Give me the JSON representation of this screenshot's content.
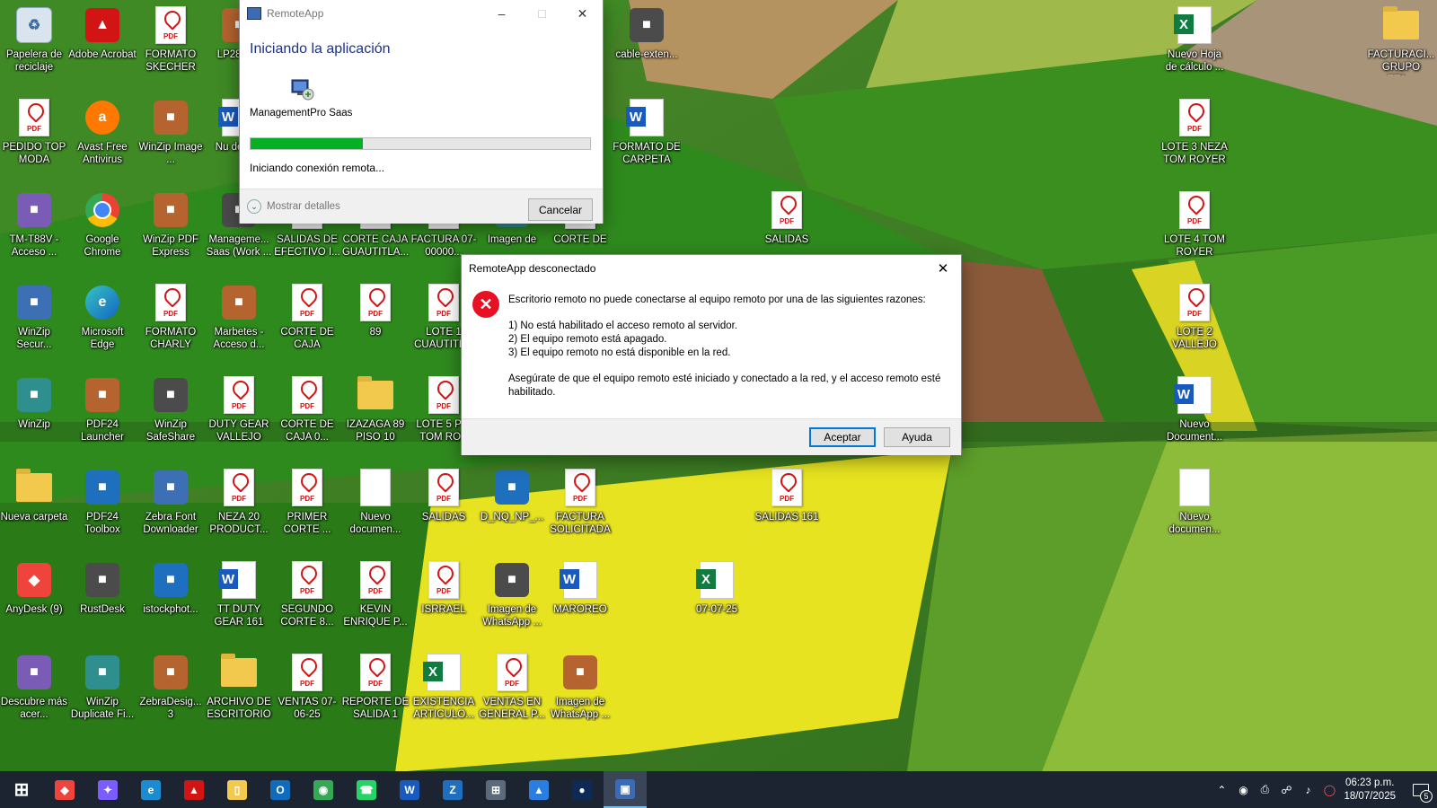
{
  "remoteapp_window": {
    "title": "RemoteApp",
    "heading": "Iniciando la aplicación",
    "app_name": "ManagementPro Saas",
    "progress": 0.33,
    "status": "Iniciando conexión remota...",
    "details_label": "Mostrar detalles",
    "cancel_label": "Cancelar"
  },
  "error_dialog": {
    "title": "RemoteApp desconectado",
    "message": "Escritorio remoto no puede conectarse al equipo remoto por una de las siguientes razones:",
    "reasons": [
      "1) No está habilitado el acceso remoto al servidor.",
      "2) El equipo remoto está apagado.",
      "3) El equipo remoto no está disponible en la red."
    ],
    "advice": "Asegúrate de que el equipo remoto esté iniciado y conectado a la red, y el acceso remoto esté habilitado.",
    "ok_label": "Aceptar",
    "help_label": "Ayuda"
  },
  "desktop_icons": [
    {
      "label": "Papelera de reciclaje",
      "type": "recycle"
    },
    {
      "label": "Adobe Acrobat",
      "type": "acrobat"
    },
    {
      "label": "FORMATO SKECHER",
      "type": "pdf"
    },
    {
      "label": "LP28 Acc",
      "type": "generic"
    },
    {
      "label": "cable-exten...",
      "type": "generic"
    },
    {
      "label": "Nuevo Hoja de cálculo ...",
      "type": "excel"
    },
    {
      "label": "FACTURACI... GRUPO ETA...",
      "type": "folder"
    },
    {
      "label": "PEDIDO TOP MODA",
      "type": "pdf"
    },
    {
      "label": "Avast Free Antivirus",
      "type": "avast"
    },
    {
      "label": "WinZip Image ...",
      "type": "generic"
    },
    {
      "label": "Nu docum",
      "type": "word"
    },
    {
      "label": "FORMATO DE CARPETA",
      "type": "word"
    },
    {
      "label": "LOTE 3 NEZA TOM ROYER",
      "type": "pdf"
    },
    {
      "label": "TM-T88V - Acceso ...",
      "type": "generic"
    },
    {
      "label": "Google Chrome",
      "type": "chrome"
    },
    {
      "label": "WinZip PDF Express",
      "type": "generic"
    },
    {
      "label": "Manageme... Saas (Work ...",
      "type": "generic"
    },
    {
      "label": "SALIDAS DE EFECTIVO I...",
      "type": "pdf"
    },
    {
      "label": "CORTE CAJA GUAUTITLA...",
      "type": "pdf"
    },
    {
      "label": "FACTURA 07-00000...",
      "type": "pdf"
    },
    {
      "label": "Imagen de",
      "type": "generic"
    },
    {
      "label": "CORTE DE",
      "type": "pdf"
    },
    {
      "label": "SALIDAS",
      "type": "pdf"
    },
    {
      "label": "LOTE 4 TOM ROYER",
      "type": "pdf"
    },
    {
      "label": "WinZip Secur...",
      "type": "generic"
    },
    {
      "label": "Microsoft Edge",
      "type": "edge"
    },
    {
      "label": "FORMATO CHARLY",
      "type": "pdf"
    },
    {
      "label": "Marbetes - Acceso d...",
      "type": "generic"
    },
    {
      "label": "CORTE DE CAJA",
      "type": "pdf"
    },
    {
      "label": "89",
      "type": "pdf"
    },
    {
      "label": "LOTE 1 CUAUTITL...",
      "type": "pdf"
    },
    {
      "label": "LOTE 2 VALLEJO",
      "type": "pdf"
    },
    {
      "label": "WinZip",
      "type": "generic"
    },
    {
      "label": "PDF24 Launcher",
      "type": "generic"
    },
    {
      "label": "WinZip SafeShare",
      "type": "generic"
    },
    {
      "label": "DUTY GEAR VALLEJO",
      "type": "pdf"
    },
    {
      "label": "CORTE DE CAJA 0...",
      "type": "pdf"
    },
    {
      "label": "IZAZAGA 89 PISO 10",
      "type": "folder"
    },
    {
      "label": "LOTE 5 PIS TOM ROY",
      "type": "pdf"
    },
    {
      "label": "Nuevo Document...",
      "type": "word"
    },
    {
      "label": "Nueva carpeta",
      "type": "folder"
    },
    {
      "label": "PDF24 Toolbox",
      "type": "generic"
    },
    {
      "label": "Zebra Font Downloader",
      "type": "generic"
    },
    {
      "label": "NEZA 20 PRODUCT...",
      "type": "pdf"
    },
    {
      "label": "PRIMER CORTE ...",
      "type": "pdf"
    },
    {
      "label": "Nuevo documen...",
      "type": "doc"
    },
    {
      "label": "SALIDAS",
      "type": "pdf"
    },
    {
      "label": "D_NQ_NP_...",
      "type": "generic"
    },
    {
      "label": "FACTURA SOLICITADA",
      "type": "pdf"
    },
    {
      "label": "SALIDAS 161",
      "type": "pdf"
    },
    {
      "label": "Nuevo documen...",
      "type": "doc"
    },
    {
      "label": "AnyDesk (9)",
      "type": "anydesk"
    },
    {
      "label": "RustDesk",
      "type": "generic"
    },
    {
      "label": "istockphot...",
      "type": "generic"
    },
    {
      "label": "TT DUTY GEAR 161",
      "type": "word"
    },
    {
      "label": "SEGUNDO CORTE 8...",
      "type": "pdf"
    },
    {
      "label": "KEVIN ENRIQUE P...",
      "type": "pdf"
    },
    {
      "label": "ISRRAEL",
      "type": "pdf"
    },
    {
      "label": "Imagen de WhatsApp ...",
      "type": "generic"
    },
    {
      "label": "MAROREO",
      "type": "word"
    },
    {
      "label": "07-07-25",
      "type": "excel"
    },
    {
      "label": "Descubre más acer...",
      "type": "generic"
    },
    {
      "label": "WinZip Duplicate Fi...",
      "type": "generic"
    },
    {
      "label": "ZebraDesig... 3",
      "type": "generic"
    },
    {
      "label": "ARCHIVO DE ESCRITORIO",
      "type": "folder"
    },
    {
      "label": "VENTAS 07-06-25",
      "type": "pdf"
    },
    {
      "label": "REPORTE DE SALIDA 1",
      "type": "pdf"
    },
    {
      "label": "EXISTENCIA ARTICULO...",
      "type": "excel"
    },
    {
      "label": "VENTAS EN GENERAL P...",
      "type": "pdf"
    },
    {
      "label": "Imagen de WhatsApp ...",
      "type": "generic"
    }
  ],
  "taskbar": {
    "apps": [
      "start-icon",
      "anydesk-icon",
      "copilot-icon",
      "edge-icon",
      "acrobat-icon",
      "file-explorer-icon",
      "outlook-icon",
      "chrome-icon",
      "whatsapp-icon",
      "word-icon",
      "zebra-designer-icon",
      "calculator-icon",
      "photos-icon",
      "marbetes-icon",
      "remote-desktop-icon"
    ],
    "time": "06:23 p.m.",
    "date": "18/07/2025",
    "notifications": "5"
  },
  "colors": {
    "progress_fill": "#06b025",
    "heading_blue": "#1e3287",
    "error_red": "#e81123",
    "taskbar": "#1c2431"
  }
}
